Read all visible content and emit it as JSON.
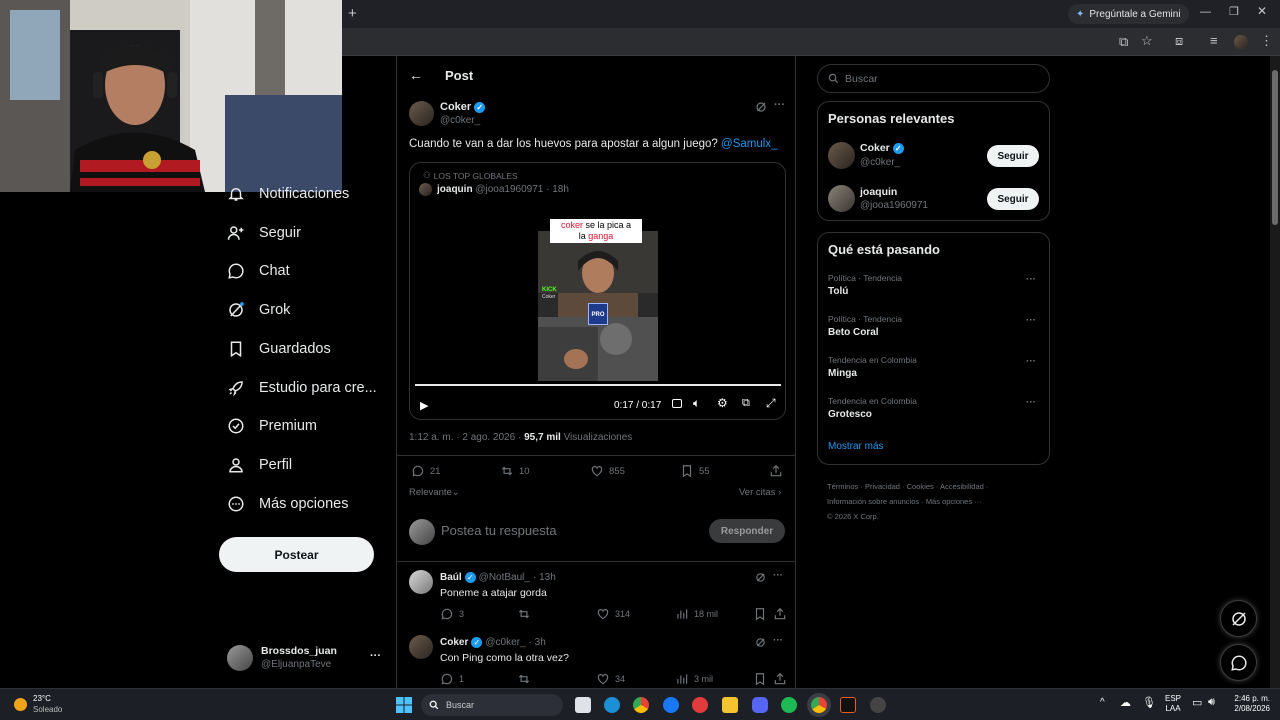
{
  "browser": {
    "gemini_label": "Pregúntale a Gemini",
    "new_tab": "+"
  },
  "sidebar": {
    "items": [
      {
        "label": "Notificaciones",
        "icon": "bell-icon"
      },
      {
        "label": "Seguir",
        "icon": "person-add-icon"
      },
      {
        "label": "Chat",
        "icon": "chat-icon"
      },
      {
        "label": "Grok",
        "icon": "grok-icon"
      },
      {
        "label": "Guardados",
        "icon": "bookmark-icon"
      },
      {
        "label": "Estudio para cre...",
        "icon": "rocket-icon"
      },
      {
        "label": "Premium",
        "icon": "premium-icon"
      },
      {
        "label": "Perfil",
        "icon": "person-icon"
      },
      {
        "label": "Más opciones",
        "icon": "more-circle-icon"
      }
    ],
    "post_button": "Postear",
    "account": {
      "name": "Brossdos_juan",
      "handle": "@EljuanpaTeve",
      "more": "···"
    }
  },
  "post": {
    "header_title": "Post",
    "author_name": "Coker",
    "author_handle": "@c0ker_",
    "text": "Cuando te van a dar los huevos para apostar a algun juego?",
    "mention": "@Samulx_",
    "quote": {
      "context": "LOS TOP GLOBALES",
      "author_name": "joaquin",
      "author_handle": "@jooa1960971",
      "time": "· 18h",
      "caption_word1": "coker",
      "caption_rest1": " se la pica a",
      "caption_line2a": "la ",
      "caption_word2": "ganga",
      "kick_label": "KICK",
      "kick_name": "Coker",
      "video_time": "0:17 / 0:17"
    },
    "timestamp": "1:12 a. m. · 2 ago. 2026 ·",
    "views_count": "95,7 mil",
    "views_label": "Visualizaciones",
    "stats": {
      "replies": "21",
      "reposts": "10",
      "likes": "855",
      "bookmarks": "55"
    },
    "sort_label": "Relevante",
    "quotes_link": "Ver citas",
    "reply_placeholder": "Postea tu respuesta",
    "reply_button": "Responder"
  },
  "replies": [
    {
      "name": "Baúl",
      "handle": "@NotBaul_",
      "time": "· 13h",
      "text": "Poneme a atajar gorda",
      "replies": "3",
      "reposts": "",
      "likes": "314",
      "views": "18 mil"
    },
    {
      "name": "Coker",
      "handle": "@c0ker_",
      "time": "· 3h",
      "text": "Con Ping como la otra vez?",
      "replies": "1",
      "reposts": "",
      "likes": "34",
      "views": "3 mil"
    }
  ],
  "right": {
    "search_placeholder": "Buscar",
    "relevant_title": "Personas relevantes",
    "people": [
      {
        "name": "Coker",
        "handle": "@c0ker_",
        "button": "Seguir"
      },
      {
        "name": "joaquin",
        "handle": "@jooa1960971",
        "button": "Seguir"
      }
    ],
    "trending_title": "Qué está pasando",
    "trends": [
      {
        "context": "Política · Tendencia",
        "name": "Tolú"
      },
      {
        "context": "Política · Tendencia",
        "name": "Beto Coral"
      },
      {
        "context": "Tendencia en Colombia",
        "name": "Minga"
      },
      {
        "context": "Tendencia en Colombia",
        "name": "Grotesco"
      }
    ],
    "show_more": "Mostrar más",
    "footer_line1": [
      "Términos",
      "Privacidad",
      "Cookies",
      "Accesibilidad"
    ],
    "footer_line2": [
      "Información sobre anuncios",
      "Más opciones ···"
    ],
    "footer_line3": "© 2026 X Corp."
  },
  "taskbar": {
    "temp": "23°C",
    "weather": "Soleado",
    "search": "Buscar",
    "lang1": "ESP",
    "lang2": "LAA",
    "time": "2:46 p. m.",
    "date": "2/08/2026"
  },
  "colors": {
    "accent": "#1d9bf0",
    "background": "#000000",
    "border": "#2f3336",
    "muted": "#71767b",
    "caption_red": "#e0142f"
  }
}
